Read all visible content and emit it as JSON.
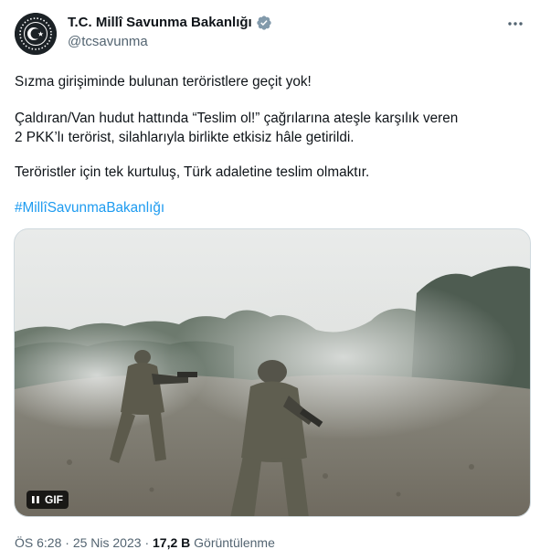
{
  "author": {
    "display_name": "T.C. Millî Savunma Bakanlığı",
    "handle": "@tcsavunma",
    "verified_badge_icon": "verified-badge-icon",
    "verified_badge_color": "#829aab"
  },
  "more_icon": "more-horizontal-icon",
  "tweet": {
    "paragraph_1": "Sızma girişiminde bulunan teröristlere geçit yok!",
    "paragraph_2_line_1": "Çaldıran/Van hudut hattında “Teslim ol!” çağrılarına ateşle karşılık veren",
    "paragraph_2_line_2": "2 PKK’lı terörist, silahlarıyla birlikte etkisiz hâle getirildi.",
    "paragraph_3": "Teröristler için tek kurtuluş, Türk adaletine teslim olmaktır.",
    "hashtag": "#MillîSavunmaBakanlığı"
  },
  "media": {
    "type": "gif",
    "gif_label": "GIF",
    "pause_icon": "pause-icon"
  },
  "meta": {
    "time": "ÖS 6:28",
    "separator": "·",
    "date": "25 Nis 2023",
    "views_count": "17,2 B",
    "views_label": "Görüntülenme"
  },
  "colors": {
    "link": "#1d9bf0",
    "secondary_text": "#536471",
    "primary_text": "#0f1419"
  }
}
